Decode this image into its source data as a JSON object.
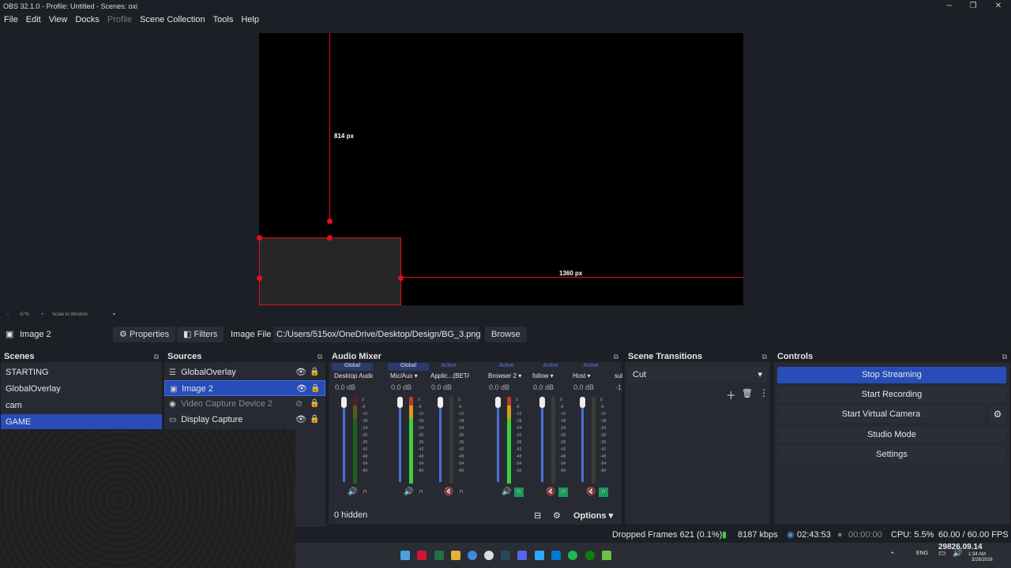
{
  "window": {
    "title": "OBS 32.1.0 - Profile: Untitled - Scenes: oxi",
    "min": "─",
    "max": "❐",
    "close": "✕"
  },
  "menu": [
    "File",
    "Edit",
    "View",
    "Docks",
    "Profile",
    "Scene Collection",
    "Tools",
    "Help"
  ],
  "preview": {
    "label_top": "814 px",
    "label_right": "1360 px"
  },
  "zoom": {
    "minus": "−",
    "level": "47%",
    "plus": "+",
    "mode": "Scale to Window"
  },
  "source_toolbar": {
    "selected": "Image 2",
    "properties": "Properties",
    "filters": "Filters",
    "image_file_label": "Image File",
    "path": "C:/Users/515ox/OneDrive/Desktop/Design/BG_3.png",
    "browse": "Browse"
  },
  "scenes": {
    "title": "Scenes",
    "items": [
      "STARTING",
      "GlobalOverlay",
      "cam",
      "GAME"
    ]
  },
  "sources": {
    "title": "Sources",
    "items": [
      "GlobalOverlay",
      "Image 2",
      "Video Capture Device 2",
      "Display Capture"
    ]
  },
  "mixer": {
    "title": "Audio Mixer",
    "hidden": "0 hidden",
    "options": "Options",
    "channels": [
      {
        "tag": "Global",
        "name": "Desktop Audio",
        "db": "0.0 dB"
      },
      {
        "tag": "Global",
        "name": "Mic/Aux",
        "db": "0.0 dB"
      },
      {
        "tag": "Active",
        "name": "Applic...(BETA)",
        "db": "0.0 dB"
      },
      {
        "tag": "Active",
        "name": "Browser 2",
        "db": "0.0 dB"
      },
      {
        "tag": "Active",
        "name": "follow",
        "db": "0.0 dB"
      },
      {
        "tag": "Active",
        "name": "Host",
        "db": "0.0 dB"
      },
      {
        "tag": "",
        "name": "sul",
        "db": "-1"
      }
    ],
    "ticks": [
      "0",
      "-6",
      "-12",
      "-18",
      "-24",
      "-30",
      "-36",
      "-42",
      "-48",
      "-54",
      "-60"
    ]
  },
  "transitions": {
    "title": "Scene Transitions",
    "selected": "Cut"
  },
  "controls": {
    "title": "Controls",
    "buttons": [
      "Stop Streaming",
      "Start Recording",
      "Start Virtual Camera",
      "Studio Mode",
      "Settings"
    ]
  },
  "status": {
    "dropped": "Dropped Frames 621 (0.1%)",
    "kbps": "8187 kbps",
    "stream_time": "02:43:53",
    "rec_time": "00:00:00",
    "cpu": "CPU: 5.5%",
    "fps": "60.00 / 60.00 FPS"
  },
  "taskbar": {
    "lang": "ENG",
    "time": "1:34 AM",
    "date": "3/28/2026",
    "overlay": "29826.09.14"
  }
}
